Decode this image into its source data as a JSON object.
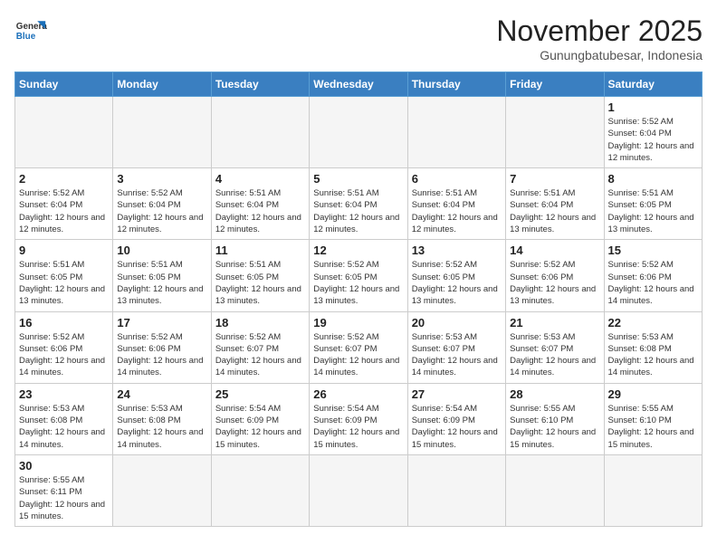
{
  "logo": {
    "text_general": "General",
    "text_blue": "Blue"
  },
  "header": {
    "month": "November 2025",
    "location": "Gunungbatubesar, Indonesia"
  },
  "days_of_week": [
    "Sunday",
    "Monday",
    "Tuesday",
    "Wednesday",
    "Thursday",
    "Friday",
    "Saturday"
  ],
  "weeks": [
    [
      {
        "day": "",
        "info": ""
      },
      {
        "day": "",
        "info": ""
      },
      {
        "day": "",
        "info": ""
      },
      {
        "day": "",
        "info": ""
      },
      {
        "day": "",
        "info": ""
      },
      {
        "day": "",
        "info": ""
      },
      {
        "day": "1",
        "info": "Sunrise: 5:52 AM\nSunset: 6:04 PM\nDaylight: 12 hours and 12 minutes."
      }
    ],
    [
      {
        "day": "2",
        "info": "Sunrise: 5:52 AM\nSunset: 6:04 PM\nDaylight: 12 hours and 12 minutes."
      },
      {
        "day": "3",
        "info": "Sunrise: 5:52 AM\nSunset: 6:04 PM\nDaylight: 12 hours and 12 minutes."
      },
      {
        "day": "4",
        "info": "Sunrise: 5:51 AM\nSunset: 6:04 PM\nDaylight: 12 hours and 12 minutes."
      },
      {
        "day": "5",
        "info": "Sunrise: 5:51 AM\nSunset: 6:04 PM\nDaylight: 12 hours and 12 minutes."
      },
      {
        "day": "6",
        "info": "Sunrise: 5:51 AM\nSunset: 6:04 PM\nDaylight: 12 hours and 12 minutes."
      },
      {
        "day": "7",
        "info": "Sunrise: 5:51 AM\nSunset: 6:04 PM\nDaylight: 12 hours and 13 minutes."
      },
      {
        "day": "8",
        "info": "Sunrise: 5:51 AM\nSunset: 6:05 PM\nDaylight: 12 hours and 13 minutes."
      }
    ],
    [
      {
        "day": "9",
        "info": "Sunrise: 5:51 AM\nSunset: 6:05 PM\nDaylight: 12 hours and 13 minutes."
      },
      {
        "day": "10",
        "info": "Sunrise: 5:51 AM\nSunset: 6:05 PM\nDaylight: 12 hours and 13 minutes."
      },
      {
        "day": "11",
        "info": "Sunrise: 5:51 AM\nSunset: 6:05 PM\nDaylight: 12 hours and 13 minutes."
      },
      {
        "day": "12",
        "info": "Sunrise: 5:52 AM\nSunset: 6:05 PM\nDaylight: 12 hours and 13 minutes."
      },
      {
        "day": "13",
        "info": "Sunrise: 5:52 AM\nSunset: 6:05 PM\nDaylight: 12 hours and 13 minutes."
      },
      {
        "day": "14",
        "info": "Sunrise: 5:52 AM\nSunset: 6:06 PM\nDaylight: 12 hours and 13 minutes."
      },
      {
        "day": "15",
        "info": "Sunrise: 5:52 AM\nSunset: 6:06 PM\nDaylight: 12 hours and 14 minutes."
      }
    ],
    [
      {
        "day": "16",
        "info": "Sunrise: 5:52 AM\nSunset: 6:06 PM\nDaylight: 12 hours and 14 minutes."
      },
      {
        "day": "17",
        "info": "Sunrise: 5:52 AM\nSunset: 6:06 PM\nDaylight: 12 hours and 14 minutes."
      },
      {
        "day": "18",
        "info": "Sunrise: 5:52 AM\nSunset: 6:07 PM\nDaylight: 12 hours and 14 minutes."
      },
      {
        "day": "19",
        "info": "Sunrise: 5:52 AM\nSunset: 6:07 PM\nDaylight: 12 hours and 14 minutes."
      },
      {
        "day": "20",
        "info": "Sunrise: 5:53 AM\nSunset: 6:07 PM\nDaylight: 12 hours and 14 minutes."
      },
      {
        "day": "21",
        "info": "Sunrise: 5:53 AM\nSunset: 6:07 PM\nDaylight: 12 hours and 14 minutes."
      },
      {
        "day": "22",
        "info": "Sunrise: 5:53 AM\nSunset: 6:08 PM\nDaylight: 12 hours and 14 minutes."
      }
    ],
    [
      {
        "day": "23",
        "info": "Sunrise: 5:53 AM\nSunset: 6:08 PM\nDaylight: 12 hours and 14 minutes."
      },
      {
        "day": "24",
        "info": "Sunrise: 5:53 AM\nSunset: 6:08 PM\nDaylight: 12 hours and 14 minutes."
      },
      {
        "day": "25",
        "info": "Sunrise: 5:54 AM\nSunset: 6:09 PM\nDaylight: 12 hours and 15 minutes."
      },
      {
        "day": "26",
        "info": "Sunrise: 5:54 AM\nSunset: 6:09 PM\nDaylight: 12 hours and 15 minutes."
      },
      {
        "day": "27",
        "info": "Sunrise: 5:54 AM\nSunset: 6:09 PM\nDaylight: 12 hours and 15 minutes."
      },
      {
        "day": "28",
        "info": "Sunrise: 5:55 AM\nSunset: 6:10 PM\nDaylight: 12 hours and 15 minutes."
      },
      {
        "day": "29",
        "info": "Sunrise: 5:55 AM\nSunset: 6:10 PM\nDaylight: 12 hours and 15 minutes."
      }
    ],
    [
      {
        "day": "30",
        "info": "Sunrise: 5:55 AM\nSunset: 6:11 PM\nDaylight: 12 hours and 15 minutes."
      },
      {
        "day": "",
        "info": ""
      },
      {
        "day": "",
        "info": ""
      },
      {
        "day": "",
        "info": ""
      },
      {
        "day": "",
        "info": ""
      },
      {
        "day": "",
        "info": ""
      },
      {
        "day": "",
        "info": ""
      }
    ]
  ]
}
